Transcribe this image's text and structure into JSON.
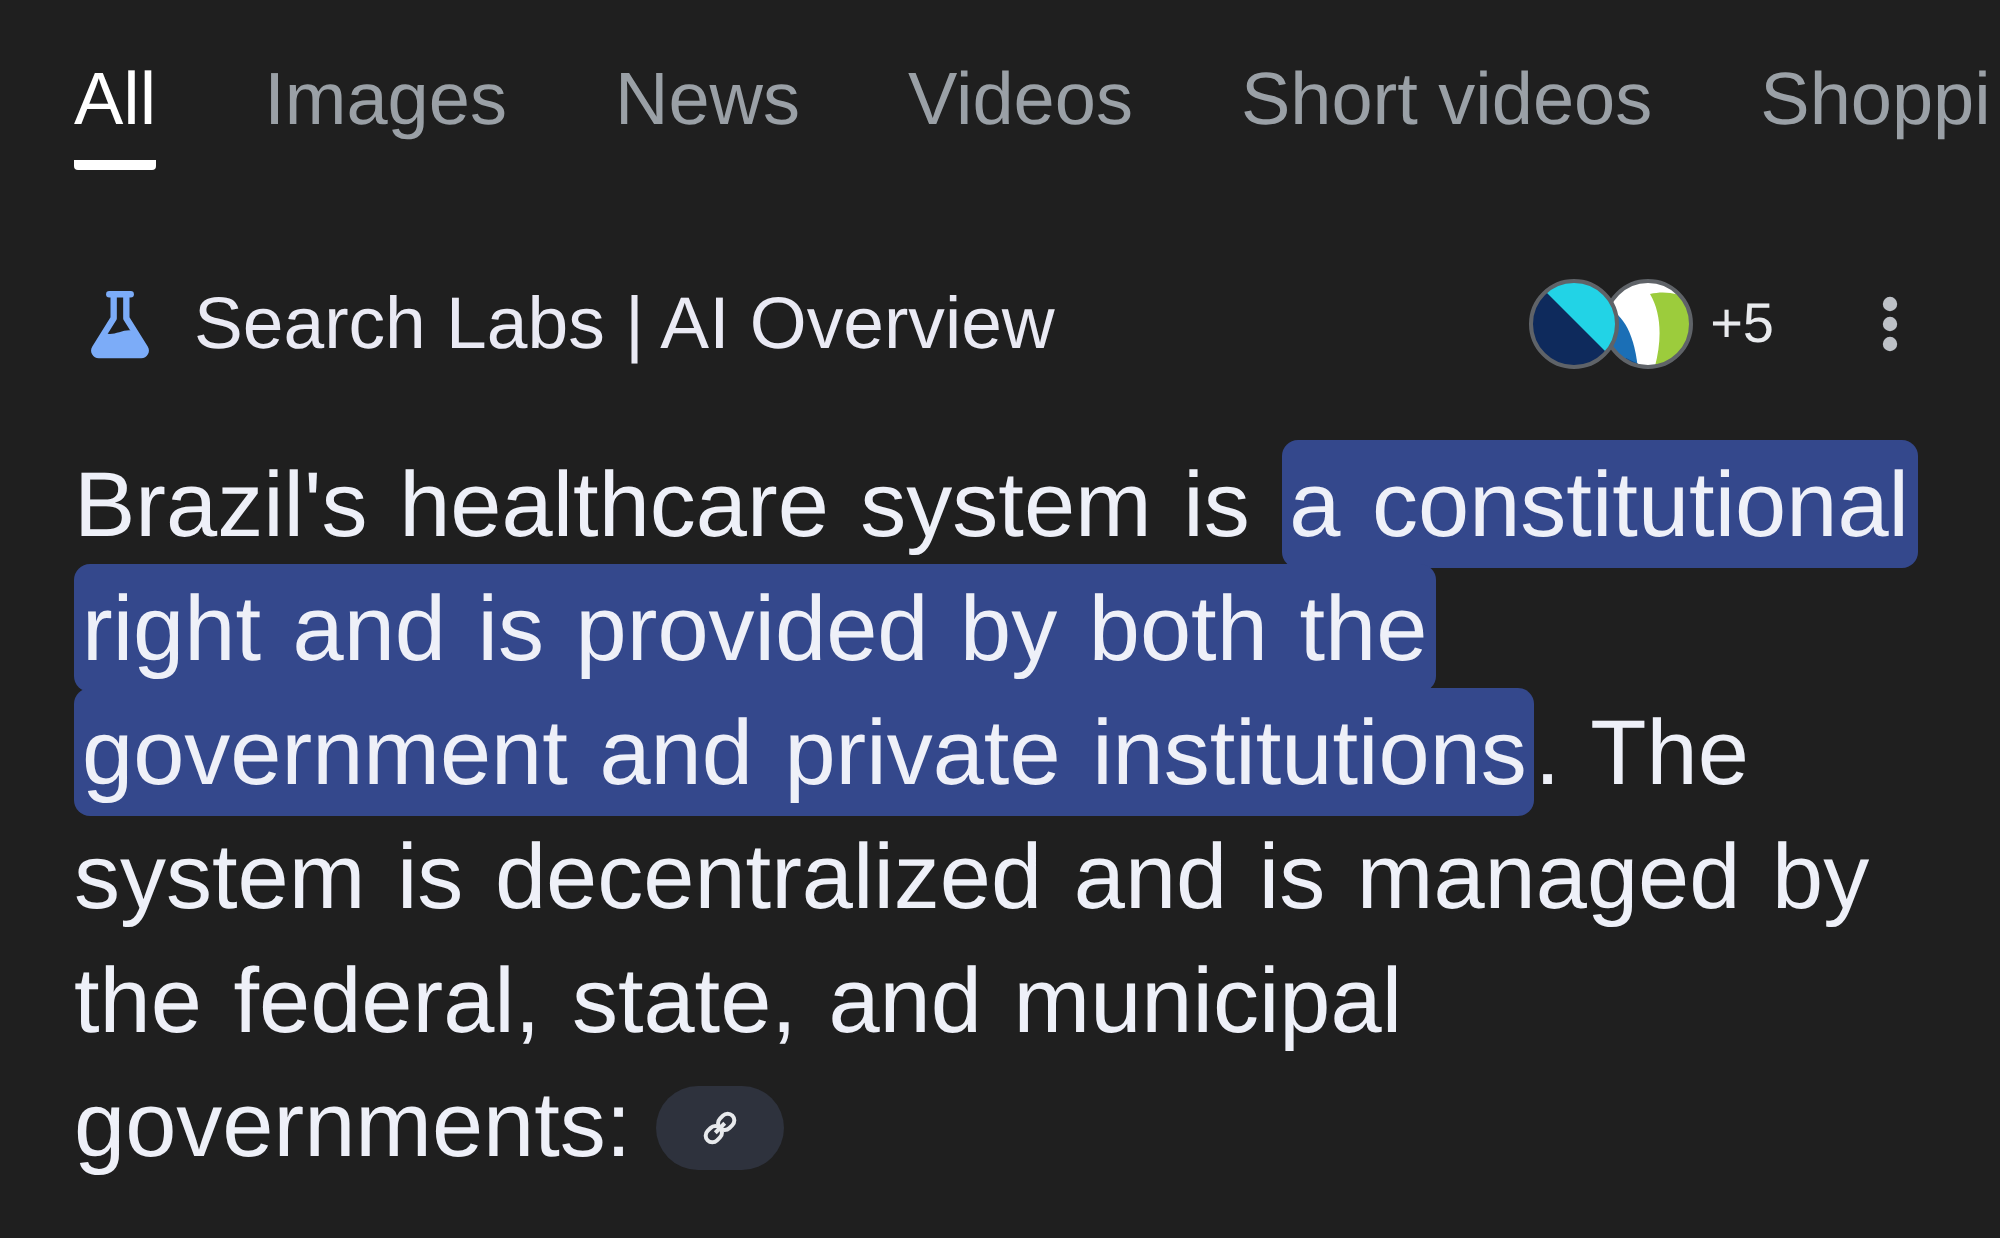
{
  "tabs": [
    {
      "label": "All",
      "selected": true
    },
    {
      "label": "Images",
      "selected": false
    },
    {
      "label": "News",
      "selected": false
    },
    {
      "label": "Videos",
      "selected": false
    },
    {
      "label": "Short videos",
      "selected": false
    },
    {
      "label": "Shoppi",
      "selected": false
    }
  ],
  "overview_header": {
    "title": "Search Labs | AI Overview",
    "sources_more": "+5"
  },
  "overview": {
    "segments": [
      {
        "text": "Brazil's healthcare system is ",
        "highlighted": false
      },
      {
        "text": "a constitutional right and is provided by both the government and private institutions",
        "highlighted": true
      },
      {
        "text": ". The system is decentralized and is managed by the federal, state, and municipal governments:",
        "highlighted": false
      }
    ]
  }
}
